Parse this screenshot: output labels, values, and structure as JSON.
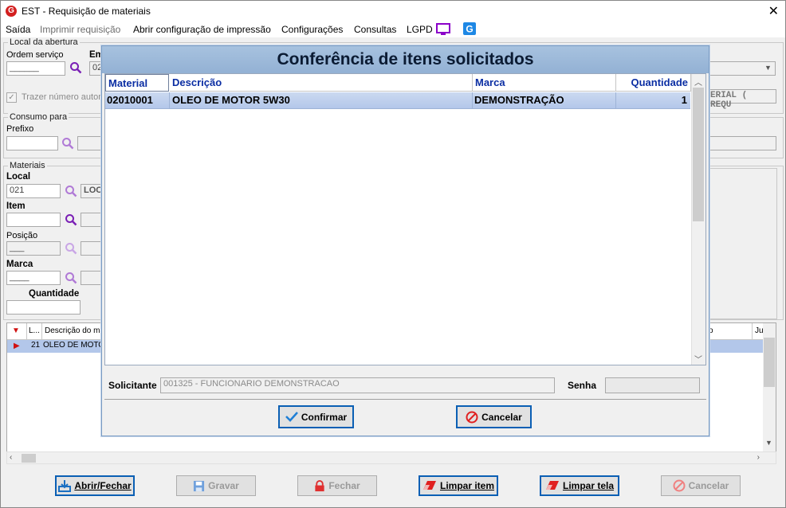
{
  "window": {
    "title": "EST - Requisição de materiais"
  },
  "menu": {
    "items": [
      "Saída",
      "Imprimir requisição",
      "Abrir configuração de impressão",
      "Configurações",
      "Consultas",
      "LGPD"
    ]
  },
  "form": {
    "local_abertura_legend": "Local da abertura",
    "ordem_servico_label": "Ordem serviço",
    "ordem_servico_value": "______",
    "em_label": "Em",
    "em_value": "02",
    "trazer_numero_label": "Trazer número autom",
    "consumo_legend": "Consumo para",
    "prefixo_label": "Prefixo",
    "materiais_legend": "Materiais",
    "local_label": "Local",
    "local_value": "021",
    "local_desc": "LOC",
    "item_label": "Item",
    "posicao_label": "Posição",
    "posicao_value": "___",
    "marca_label": "Marca",
    "marca_value": "____",
    "quantidade_label": "Quantidade",
    "right_text": "ERIAL ( REQU"
  },
  "bg_grid": {
    "headers": [
      "L...",
      "Descrição do ma",
      "o",
      "Ju"
    ],
    "row": {
      "local": "21",
      "descricao": "OLEO DE MOTOR"
    }
  },
  "modal": {
    "title": "Conferência de itens solicitados",
    "columns": [
      "Material",
      "Descrição",
      "Marca",
      "Quantidade"
    ],
    "rows": [
      {
        "material": "02010001",
        "descricao": "OLEO DE MOTOR 5W30",
        "marca": "DEMONSTRAÇÃO",
        "quantidade": "1"
      }
    ],
    "solicitante_label": "Solicitante",
    "solicitante_value": "001325 - FUNCIONARIO DEMONSTRACAO",
    "senha_label": "Senha",
    "confirmar_label": "Confirmar",
    "cancelar_label": "Cancelar"
  },
  "bottom_buttons": {
    "abrir_fechar": "Abrir/Fechar",
    "gravar": "Gravar",
    "fechar": "Fechar",
    "limpar_item": "Limpar item",
    "limpar_tela": "Limpar tela",
    "cancelar": "Cancelar"
  },
  "colors": {
    "accent": "#0b2ea3",
    "selected_row": "#b3c7ea",
    "modal_title_bg": "#a7c2df"
  }
}
